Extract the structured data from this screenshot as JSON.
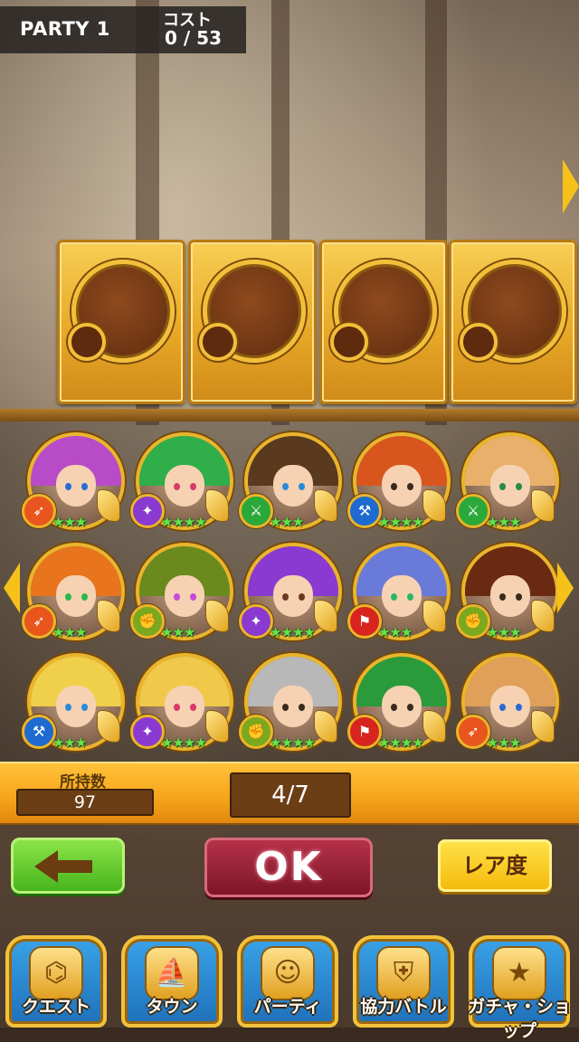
{
  "header": {
    "party_label": "PARTY 1",
    "cost_label": "コスト",
    "cost_value": "0 / 53"
  },
  "slots": [
    "empty",
    "empty",
    "empty",
    "empty"
  ],
  "characters": [
    {
      "attr_icon": "bow-icon",
      "attr_glyph": "➶",
      "attr_color": "#e8561e",
      "hair": "#b84bc8",
      "eye": "#2a6ad8",
      "stars": "★★★"
    },
    {
      "attr_icon": "staff-icon",
      "attr_glyph": "✦",
      "attr_color": "#8a3ad0",
      "hair": "#2fae4a",
      "eye": "#d83a6a",
      "stars": "★★★★"
    },
    {
      "attr_icon": "sword-icon",
      "attr_glyph": "⚔",
      "attr_color": "#2aa83a",
      "hair": "#5a3a1e",
      "eye": "#2a8ad8",
      "stars": "★★★"
    },
    {
      "attr_icon": "axe-icon",
      "attr_glyph": "⚒",
      "attr_color": "#1e6ad0",
      "hair": "#d8561e",
      "eye": "#3a2a1e",
      "stars": "★★★★"
    },
    {
      "attr_icon": "sword-icon",
      "attr_glyph": "⚔",
      "attr_color": "#2aa83a",
      "hair": "#e8b06a",
      "eye": "#2a8a4a",
      "stars": "★★★"
    },
    {
      "attr_icon": "bow-icon",
      "attr_glyph": "➶",
      "attr_color": "#e8561e",
      "hair": "#e8741e",
      "eye": "#2ab84a",
      "stars": "★★★"
    },
    {
      "attr_icon": "fist-icon",
      "attr_glyph": "✊",
      "attr_color": "#7aa81e",
      "hair": "#6a8a1e",
      "eye": "#c84ad8",
      "stars": "★★★"
    },
    {
      "attr_icon": "staff-icon",
      "attr_glyph": "✦",
      "attr_color": "#8a3ad0",
      "hair": "#8a3ad0",
      "eye": "#6a3a1e",
      "stars": "★★★★"
    },
    {
      "attr_icon": "spear-icon",
      "attr_glyph": "⚑",
      "attr_color": "#d8241e",
      "hair": "#6a7ad8",
      "eye": "#2ab86a",
      "stars": "★★★"
    },
    {
      "attr_icon": "fist-icon",
      "attr_glyph": "✊",
      "attr_color": "#7aa81e",
      "hair": "#6a2a12",
      "eye": "#3a2a1e",
      "stars": "★★★"
    },
    {
      "attr_icon": "axe-icon",
      "attr_glyph": "⚒",
      "attr_color": "#1e6ad0",
      "hair": "#f0d04a",
      "eye": "#2a8ad8",
      "stars": "★★★"
    },
    {
      "attr_icon": "staff-icon",
      "attr_glyph": "✦",
      "attr_color": "#8a3ad0",
      "hair": "#f0c84a",
      "eye": "#d83a6a",
      "stars": "★★★★"
    },
    {
      "attr_icon": "fist-icon",
      "attr_glyph": "✊",
      "attr_color": "#7aa81e",
      "hair": "#b8b8b8",
      "eye": "#3a2a1e",
      "stars": "★★★★"
    },
    {
      "attr_icon": "spear-icon",
      "attr_glyph": "⚑",
      "attr_color": "#d8241e",
      "hair": "#2a9a3a",
      "eye": "#3a2a1e",
      "stars": "★★★★"
    },
    {
      "attr_icon": "bow-icon",
      "attr_glyph": "➶",
      "attr_color": "#e8561e",
      "hair": "#e0a05a",
      "eye": "#2a6ad8",
      "stars": "★★★"
    }
  ],
  "status": {
    "owned_label": "所持数",
    "owned_value": "97",
    "page_value": "4/7"
  },
  "buttons": {
    "ok_label": "OK",
    "rarity_label": "レア度"
  },
  "nav": [
    {
      "label": "クエスト",
      "icon": "quest-map-icon",
      "glyph": "⌬"
    },
    {
      "label": "タウン",
      "icon": "town-ship-icon",
      "glyph": "⛵"
    },
    {
      "label": "パーティ",
      "icon": "party-icon",
      "glyph": "☺"
    },
    {
      "label": "協力バトル",
      "icon": "coop-battle-shield-icon",
      "glyph": "⛨"
    },
    {
      "label": "ガチャ・ショップ",
      "icon": "gacha-star-icon",
      "glyph": "★"
    }
  ]
}
